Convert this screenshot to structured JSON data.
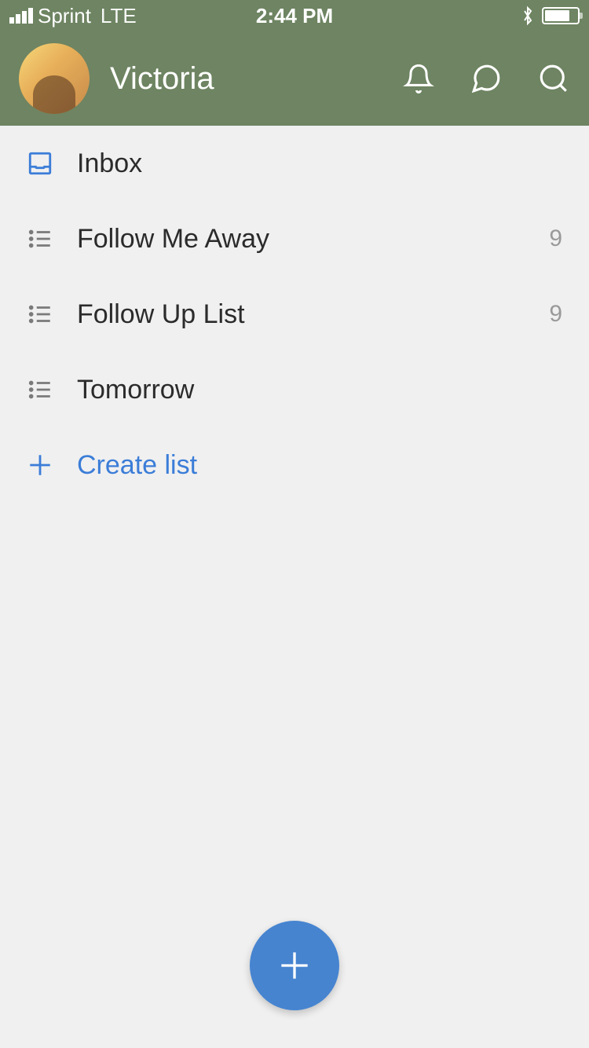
{
  "status_bar": {
    "carrier": "Sprint",
    "network": "LTE",
    "time": "2:44 PM"
  },
  "header": {
    "username": "Victoria"
  },
  "lists": [
    {
      "icon": "inbox",
      "label": "Inbox",
      "count": null
    },
    {
      "icon": "list",
      "label": "Follow Me Away",
      "count": "9"
    },
    {
      "icon": "list",
      "label": "Follow Up List",
      "count": "9"
    },
    {
      "icon": "list",
      "label": "Tomorrow",
      "count": null
    }
  ],
  "create_list_label": "Create list"
}
